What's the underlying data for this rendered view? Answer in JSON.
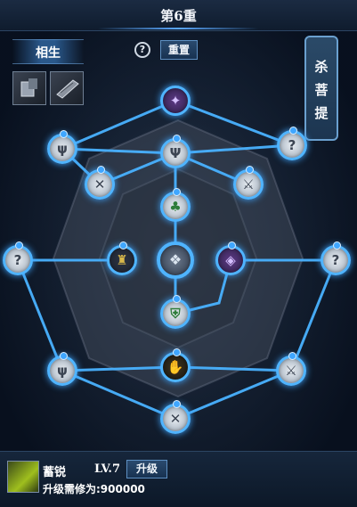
{
  "header": {
    "title": "第6重"
  },
  "toolbar": {
    "relation_tab": "相生",
    "help_glyph": "?",
    "reset_label": "重置"
  },
  "skills": [
    {
      "icon": "armor-skill-icon"
    },
    {
      "icon": "book-skill-icon"
    }
  ],
  "side_tab": {
    "chars": [
      "杀",
      "菩",
      "提"
    ]
  },
  "colors": {
    "accent": "#4fb4ff",
    "background": "#0a1524",
    "gold": "#f0c23a"
  },
  "nodes": [
    {
      "id": "top",
      "icon": "purple-crest-icon"
    },
    {
      "id": "upper-left",
      "icon": "wing-claw-icon"
    },
    {
      "id": "upper-mid",
      "icon": "flame-fork-icon"
    },
    {
      "id": "upper-right",
      "icon": "question-swirl-icon"
    },
    {
      "id": "ring-left",
      "icon": "cross-rune-icon"
    },
    {
      "id": "ring-right",
      "icon": "sword-rune-icon"
    },
    {
      "id": "mid-green",
      "icon": "green-leaf-icon"
    },
    {
      "id": "far-left",
      "icon": "question-swirl-icon"
    },
    {
      "id": "inner-left",
      "icon": "gold-tower-icon"
    },
    {
      "id": "center",
      "icon": "center-emblem-icon"
    },
    {
      "id": "inner-right",
      "icon": "purple-shield-icon"
    },
    {
      "id": "far-right",
      "icon": "question-swirl-icon"
    },
    {
      "id": "lower-mid",
      "icon": "green-shield-icon"
    },
    {
      "id": "gold-hand",
      "icon": "gold-hand-icon"
    },
    {
      "id": "lower-left",
      "icon": "wing-claw-icon"
    },
    {
      "id": "lower-right",
      "icon": "sword-rune-icon"
    },
    {
      "id": "bottom",
      "icon": "cross-rune-icon"
    }
  ],
  "footer": {
    "name": "蓄锐",
    "level": "LV.7",
    "upgrade_label": "升级",
    "requirement": "升级需修为:900000"
  }
}
